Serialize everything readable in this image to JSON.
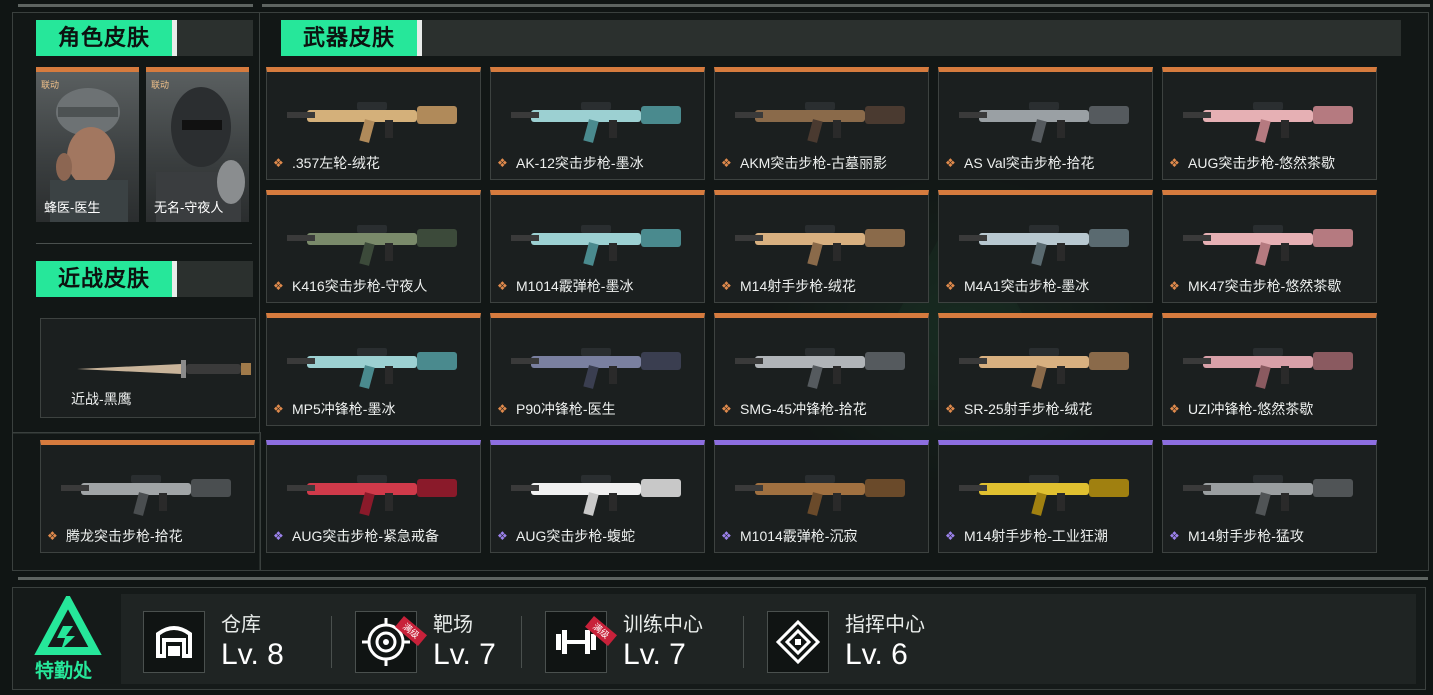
{
  "character_section": {
    "title": "角色皮肤",
    "items": [
      {
        "tag": "联动",
        "label": "蜂医-医生"
      },
      {
        "tag": "联动",
        "label": "无名-守夜人"
      }
    ]
  },
  "melee_section": {
    "title": "近战皮肤",
    "items": [
      {
        "label": "近战-黑鹰"
      }
    ]
  },
  "weapon_section": {
    "title": "武器皮肤",
    "items": [
      {
        "label": ".357左轮-绒花",
        "rarity": "orange"
      },
      {
        "label": "AK-12突击步枪-墨冰",
        "rarity": "orange"
      },
      {
        "label": "AKM突击步枪-古墓丽影",
        "rarity": "orange"
      },
      {
        "label": "AS Val突击步枪-拾花",
        "rarity": "orange"
      },
      {
        "label": "AUG突击步枪-悠然茶歇",
        "rarity": "orange"
      },
      {
        "label": "K416突击步枪-守夜人",
        "rarity": "orange"
      },
      {
        "label": "M1014霰弹枪-墨冰",
        "rarity": "orange"
      },
      {
        "label": "M14射手步枪-绒花",
        "rarity": "orange"
      },
      {
        "label": "M4A1突击步枪-墨冰",
        "rarity": "orange"
      },
      {
        "label": "MK47突击步枪-悠然茶歇",
        "rarity": "orange"
      },
      {
        "label": "MP5冲锋枪-墨冰",
        "rarity": "orange"
      },
      {
        "label": "P90冲锋枪-医生",
        "rarity": "orange"
      },
      {
        "label": "SMG-45冲锋枪-拾花",
        "rarity": "orange"
      },
      {
        "label": "SR-25射手步枪-绒花",
        "rarity": "orange"
      },
      {
        "label": "UZI冲锋枪-悠然茶歇",
        "rarity": "orange"
      },
      {
        "label": "腾龙突击步枪-拾花",
        "rarity": "orange"
      },
      {
        "label": "AUG突击步枪-紧急戒备",
        "rarity": "purple"
      },
      {
        "label": "AUG突击步枪-蝮蛇",
        "rarity": "purple"
      },
      {
        "label": "M1014霰弹枪-沉寂",
        "rarity": "purple"
      },
      {
        "label": "M14射手步枪-工业狂潮",
        "rarity": "purple"
      },
      {
        "label": "M14射手步枪-猛攻",
        "rarity": "purple"
      }
    ]
  },
  "colors": {
    "accent": "#26e79a",
    "orange": "#d67b3e",
    "purple": "#8d6ee0"
  },
  "footer": {
    "logo_text": "特勤处",
    "facilities": [
      {
        "name": "仓库",
        "level": "Lv. 8",
        "icon": "warehouse-icon",
        "badge": ""
      },
      {
        "name": "靶场",
        "level": "Lv. 7",
        "icon": "target-icon",
        "badge": "满级"
      },
      {
        "name": "训练中心",
        "level": "Lv. 7",
        "icon": "dumbbell-icon",
        "badge": "满级"
      },
      {
        "name": "指挥中心",
        "level": "Lv. 6",
        "icon": "command-icon",
        "badge": ""
      }
    ]
  }
}
